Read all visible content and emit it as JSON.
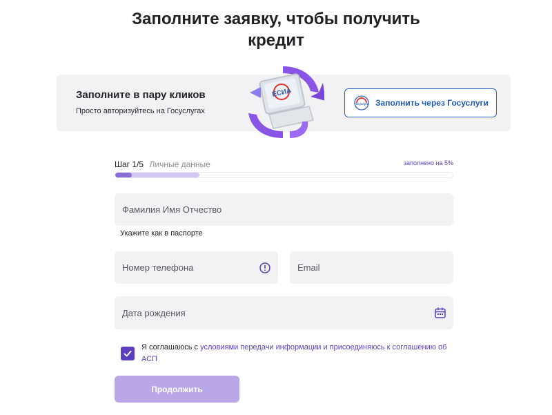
{
  "page": {
    "title_line1": "Заполните заявку, чтобы получить",
    "title_line2": "кредит"
  },
  "gosuslugi": {
    "heading": "Заполните в пару кликов",
    "subheading": "Просто авторизуйтесь на Госуслугах",
    "illustration_text": "ЕСИА",
    "logo_text": "Госуслуги",
    "button_label": "Заполнить через Госуслуги"
  },
  "progress": {
    "step": "Шаг 1/5",
    "step_name": "Личные данные",
    "label": "заполнено на 5%",
    "percent": 5,
    "step_stage_fraction": 0.25
  },
  "form": {
    "full_name": {
      "placeholder": "Фамилия Имя Отчество",
      "value": "",
      "hint": "Укажите как в паспорте"
    },
    "phone": {
      "placeholder": "Номер телефона",
      "value": ""
    },
    "email": {
      "placeholder": "Email",
      "value": ""
    },
    "birth_date": {
      "placeholder": "Дата рождения",
      "value": ""
    }
  },
  "consent": {
    "checked": true,
    "text_prefix": "Я соглашаюсь с ",
    "link_text": "условиями передачи информации и присоединяюсь к соглашению об АСП"
  },
  "actions": {
    "continue_label": "Продолжить"
  },
  "colors": {
    "accent": "#5b3fc0",
    "accent_light": "#b9a7e8",
    "gos_blue": "#2f63c6",
    "field_bg": "#f2f1f3"
  },
  "icons": {
    "phone_info": "info-circle-icon",
    "date": "calendar-icon",
    "checkbox": "checkmark-icon",
    "gosuslugi": "gosuslugi-logo"
  }
}
